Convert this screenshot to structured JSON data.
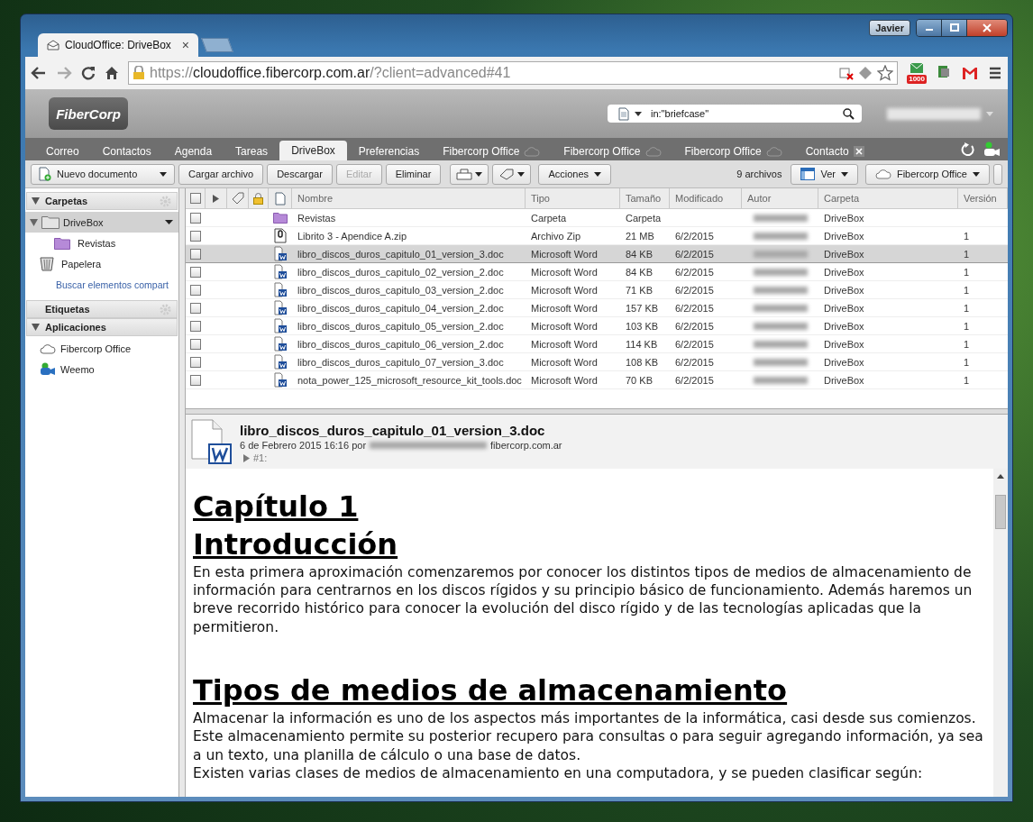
{
  "window": {
    "user": "Javier"
  },
  "browser": {
    "tab_title": "CloudOffice: DriveBox",
    "tab_close": "×",
    "address": {
      "scheme": "https://",
      "host": "cloudoffice.fibercorp.com.ar",
      "path": "/?client=advanced#41"
    },
    "badge": "1000"
  },
  "header": {
    "logo": "FiberCorp",
    "search": {
      "value": "in:\"briefcase\""
    }
  },
  "tabs": [
    {
      "label": "Correo",
      "selected": false,
      "kind": "plain"
    },
    {
      "label": "Contactos",
      "selected": false,
      "kind": "plain"
    },
    {
      "label": "Agenda",
      "selected": false,
      "kind": "plain"
    },
    {
      "label": "Tareas",
      "selected": false,
      "kind": "plain"
    },
    {
      "label": "DriveBox",
      "selected": true,
      "kind": "plain"
    },
    {
      "label": "Preferencias",
      "selected": false,
      "kind": "plain"
    },
    {
      "label": "Fibercorp Office",
      "selected": false,
      "kind": "app"
    },
    {
      "label": "Fibercorp Office",
      "selected": false,
      "kind": "app"
    },
    {
      "label": "Fibercorp Office",
      "selected": false,
      "kind": "app"
    },
    {
      "label": "Contacto",
      "selected": false,
      "kind": "closable"
    }
  ],
  "toolbar": {
    "buttons": [
      {
        "label": "Nuevo documento",
        "kind": "new",
        "disabled": false
      },
      {
        "label": "Cargar archivo",
        "kind": "plain",
        "disabled": false
      },
      {
        "label": "Descargar",
        "kind": "plain",
        "disabled": false
      },
      {
        "label": "Editar",
        "kind": "plain",
        "disabled": true
      },
      {
        "label": "Eliminar",
        "kind": "plain",
        "disabled": false
      },
      {
        "kind": "move"
      },
      {
        "kind": "tag"
      },
      {
        "label": "Acciones",
        "kind": "menu",
        "disabled": false
      }
    ],
    "count": "9 archivos",
    "right_buttons": [
      {
        "label": "Ver",
        "kind": "view"
      },
      {
        "label": "Fibercorp Office",
        "kind": "office"
      }
    ]
  },
  "sidebar": {
    "sections": [
      {
        "title": "Carpetas",
        "expanded": true,
        "gear": true,
        "items": [
          {
            "label": "DriveBox",
            "kind": "folder-grey",
            "selected": true,
            "expanded": true,
            "children": [
              {
                "label": "Revistas",
                "kind": "folder",
                "selected": false
              }
            ]
          },
          {
            "label": "Papelera",
            "kind": "trash",
            "selected": false
          },
          {
            "label": "Buscar elementos compart",
            "kind": "link",
            "selected": false
          }
        ]
      },
      {
        "title": "Etiquetas",
        "expanded": false,
        "gear": true
      },
      {
        "title": "Aplicaciones",
        "expanded": true,
        "gear": false,
        "items": [
          {
            "label": "Fibercorp Office",
            "kind": "office",
            "selected": false
          },
          {
            "label": "Weemo",
            "kind": "weemo",
            "selected": false
          }
        ]
      }
    ]
  },
  "table": {
    "select_all": false,
    "columns": [
      "Nombre",
      "Tipo",
      "Tamaño",
      "Modificado",
      "Autor",
      "Carpeta",
      "Versión"
    ],
    "rows": [
      {
        "kind": "folder",
        "selected": false,
        "checked": false,
        "name": "Revistas",
        "type": "Carpeta",
        "size": "Carpeta",
        "modified": "",
        "folder": "DriveBox",
        "version": ""
      },
      {
        "kind": "zip",
        "selected": false,
        "checked": false,
        "name": "Librito 3 - Apendice A.zip",
        "type": "Archivo Zip",
        "size": "21 MB",
        "modified": "6/2/2015",
        "folder": "DriveBox",
        "version": "1"
      },
      {
        "kind": "word",
        "selected": true,
        "checked": false,
        "name": "libro_discos_duros_capitulo_01_version_3.doc",
        "type": "Microsoft Word",
        "size": "84 KB",
        "modified": "6/2/2015",
        "folder": "DriveBox",
        "version": "1"
      },
      {
        "kind": "word",
        "selected": false,
        "checked": false,
        "name": "libro_discos_duros_capitulo_02_version_2.doc",
        "type": "Microsoft Word",
        "size": "84 KB",
        "modified": "6/2/2015",
        "folder": "DriveBox",
        "version": "1"
      },
      {
        "kind": "word",
        "selected": false,
        "checked": false,
        "name": "libro_discos_duros_capitulo_03_version_2.doc",
        "type": "Microsoft Word",
        "size": "71 KB",
        "modified": "6/2/2015",
        "folder": "DriveBox",
        "version": "1"
      },
      {
        "kind": "word",
        "selected": false,
        "checked": false,
        "name": "libro_discos_duros_capitulo_04_version_2.doc",
        "type": "Microsoft Word",
        "size": "157 KB",
        "modified": "6/2/2015",
        "folder": "DriveBox",
        "version": "1"
      },
      {
        "kind": "word",
        "selected": false,
        "checked": false,
        "name": "libro_discos_duros_capitulo_05_version_2.doc",
        "type": "Microsoft Word",
        "size": "103 KB",
        "modified": "6/2/2015",
        "folder": "DriveBox",
        "version": "1"
      },
      {
        "kind": "word",
        "selected": false,
        "checked": false,
        "name": "libro_discos_duros_capitulo_06_version_2.doc",
        "type": "Microsoft Word",
        "size": "114 KB",
        "modified": "6/2/2015",
        "folder": "DriveBox",
        "version": "1"
      },
      {
        "kind": "word",
        "selected": false,
        "checked": false,
        "name": "libro_discos_duros_capitulo_07_version_3.doc",
        "type": "Microsoft Word",
        "size": "108 KB",
        "modified": "6/2/2015",
        "folder": "DriveBox",
        "version": "1"
      },
      {
        "kind": "word",
        "selected": false,
        "checked": false,
        "name": "nota_power_125_microsoft_resource_kit_tools.doc",
        "type": "Microsoft Word",
        "size": "70 KB",
        "modified": "6/2/2015",
        "folder": "DriveBox",
        "version": "1"
      }
    ]
  },
  "preview": {
    "title": "libro_discos_duros_capitulo_01_version_3.doc",
    "meta": "6 de Febrero 2015 16:16 por",
    "email_domain": "fibercorp.com.ar",
    "version": "#1:",
    "document": [
      {
        "kind": "heading",
        "text": "Capítulo 1"
      },
      {
        "kind": "heading",
        "text": "Introducción"
      },
      {
        "kind": "paragraph",
        "text": "En esta primera aproximación comenzaremos por conocer los distintos tipos de medios de almacenamiento de información para centrarnos en los discos rígidos y su principio básico de funcionamiento. Además haremos un breve recorrido histórico para conocer la evolución del disco rígido y de las tecnologías aplicadas que la permitieron."
      },
      {
        "kind": "spacer"
      },
      {
        "kind": "heading",
        "text": "Tipos de medios de almacenamiento"
      },
      {
        "kind": "paragraph",
        "text": "Almacenar la información es uno de los aspectos más importantes de la informática, casi desde sus comienzos. Este almacenamiento permite su posterior recupero para consultas o para seguir agregando información, ya sea a un texto, una planilla de cálculo o una base de datos."
      },
      {
        "kind": "paragraph",
        "text": "Existen varias clases de medios de almacenamiento en una computadora, y se pueden clasificar según:"
      }
    ]
  }
}
